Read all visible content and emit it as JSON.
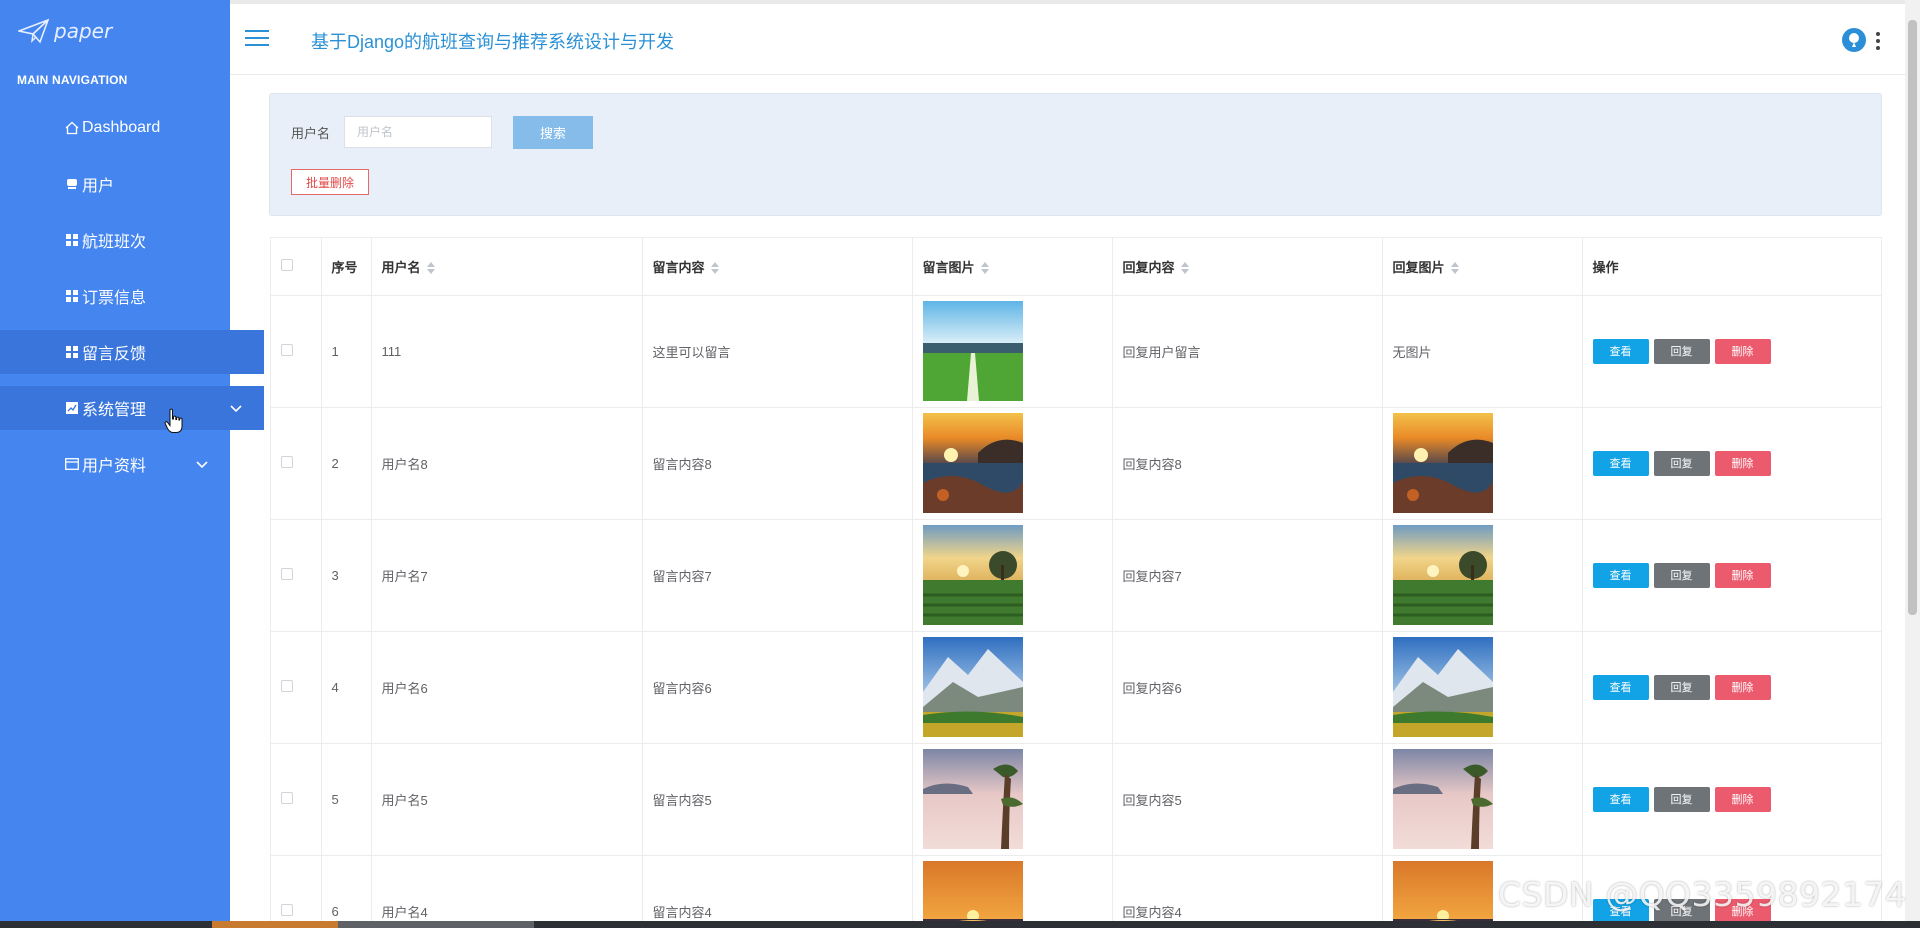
{
  "sidebar": {
    "logo_text": "paper",
    "heading": "MAIN NAVIGATION",
    "items": [
      {
        "label": "Dashboard",
        "icon": "home-icon"
      },
      {
        "label": "用户",
        "icon": "user-icon"
      },
      {
        "label": "航班班次",
        "icon": "grid-icon"
      },
      {
        "label": "订票信息",
        "icon": "grid-icon"
      },
      {
        "label": "留言反馈",
        "icon": "grid-icon",
        "active": true
      },
      {
        "label": "系统管理",
        "icon": "grid-icon",
        "active": true,
        "expandable": true
      },
      {
        "label": "用户资料",
        "icon": "card-icon",
        "expandable": true
      }
    ],
    "colors": {
      "background": "#4485f0",
      "active": "#3a75dc"
    }
  },
  "header": {
    "title": "基于Django的航班查询与推荐系统设计与开发"
  },
  "search": {
    "label": "用户名",
    "placeholder": "用户名",
    "search_button": "搜索",
    "batch_delete_button": "批量删除"
  },
  "table": {
    "columns": [
      "序号",
      "用户名",
      "留言内容",
      "留言图片",
      "回复内容",
      "回复图片",
      "操作"
    ],
    "actions": {
      "view": "查看",
      "reply": "回复",
      "delete": "删除"
    },
    "rows": [
      {
        "index": "1",
        "username": "111",
        "content": "这里可以留言",
        "image": "field",
        "reply": "回复用户留言",
        "reply_image": "",
        "reply_image_text": "无图片"
      },
      {
        "index": "2",
        "username": "用户名8",
        "content": "留言内容8",
        "image": "sunset-sea",
        "reply": "回复内容8",
        "reply_image": "sunset-sea",
        "reply_image_text": ""
      },
      {
        "index": "3",
        "username": "用户名7",
        "content": "留言内容7",
        "image": "sunrise-field",
        "reply": "回复内容7",
        "reply_image": "sunrise-field",
        "reply_image_text": ""
      },
      {
        "index": "4",
        "username": "用户名6",
        "content": "留言内容6",
        "image": "mountain",
        "reply": "回复内容6",
        "reply_image": "mountain",
        "reply_image_text": ""
      },
      {
        "index": "5",
        "username": "用户名5",
        "content": "留言内容5",
        "image": "misty-tree",
        "reply": "回复内容5",
        "reply_image": "misty-tree",
        "reply_image_text": ""
      },
      {
        "index": "6",
        "username": "用户名4",
        "content": "留言内容4",
        "image": "sunset-orange",
        "reply": "回复内容4",
        "reply_image": "sunset-orange",
        "reply_image_text": ""
      }
    ]
  },
  "watermark": "CSDN @QQ3359892174"
}
